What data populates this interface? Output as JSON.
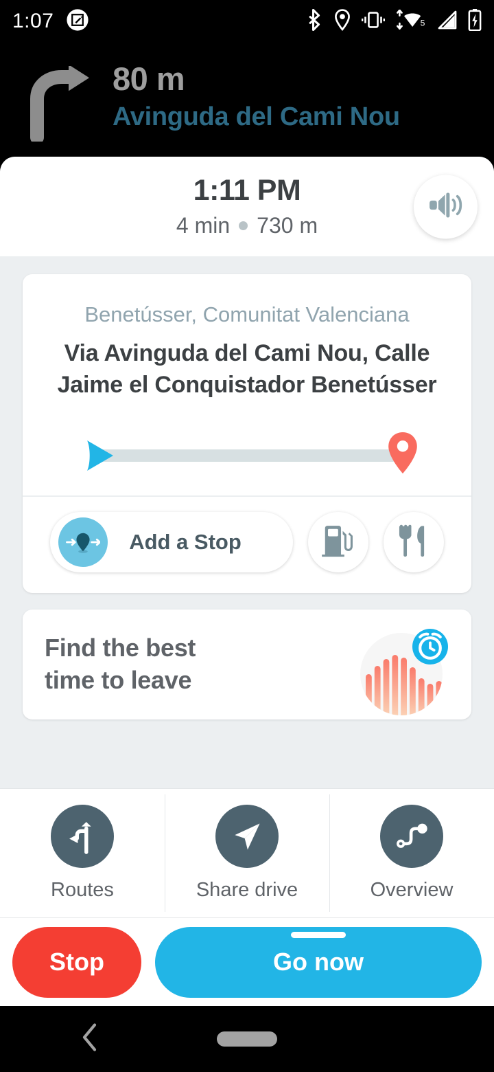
{
  "statusbar": {
    "clock": "1:07",
    "icons": [
      "screenshot-markup-icon",
      "bluetooth-icon",
      "location-icon",
      "vibrate-icon",
      "wifi-icon",
      "cellular-signal-icon",
      "battery-charging-icon"
    ],
    "wifi_badge": "5"
  },
  "nav_header": {
    "maneuver_icon": "turn-right-icon",
    "distance": "80 m",
    "street": "Avinguda del Cami Nou",
    "distance_color": "#9e9e9e",
    "street_color": "#2e6a85"
  },
  "eta": {
    "arrival_time": "1:11 PM",
    "duration": "4 min",
    "separator": "•",
    "distance": "730 m",
    "sound_button_label": "sound-on-icon"
  },
  "route_card": {
    "region": "Benetússer, Comunitat Valenciana",
    "via": "Via Avinguda del Cami Nou, Calle Jaime el Conquistador Benetússer",
    "progress": {
      "start_icon": "navigation-arrow-icon",
      "end_icon": "destination-pin-icon",
      "percent": 0,
      "track_color": "#d7e0e2",
      "start_color": "#22b5e6",
      "end_color": "#f96b5f"
    },
    "add_stop_label": "Add a Stop",
    "add_stop_icon": "add-stop-pin-icon",
    "gas_icon": "gas-station-icon",
    "food_icon": "restaurant-icon"
  },
  "leave_card": {
    "title_line1": "Find the best",
    "title_line2": "time to leave",
    "graphic": "traffic-histogram-with-alarm-clock-icon",
    "accent": "#17b3ea"
  },
  "action_bar": {
    "items": [
      {
        "label": "Routes",
        "icon": "routes-fork-icon"
      },
      {
        "label": "Share drive",
        "icon": "share-paper-plane-icon"
      },
      {
        "label": "Overview",
        "icon": "route-overview-icon"
      }
    ]
  },
  "bottom_buttons": {
    "stop_label": "Stop",
    "stop_color": "#f43e33",
    "go_label": "Go now",
    "go_color": "#22b5e6"
  },
  "navbar": {
    "back_icon": "back-chevron-icon",
    "home_icon": "home-pill-icon"
  }
}
